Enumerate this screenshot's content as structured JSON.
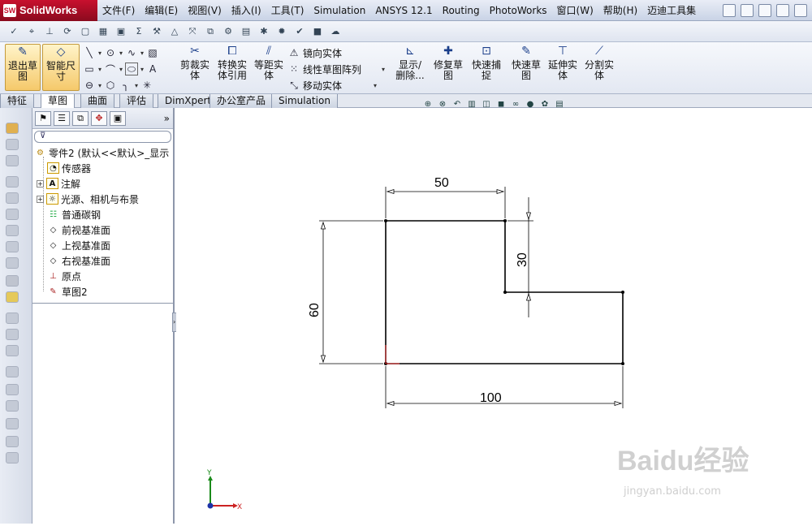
{
  "app": {
    "logo_text": "SolidWorks",
    "logo_mark": "SW"
  },
  "menu": [
    "文件(F)",
    "编辑(E)",
    "视图(V)",
    "插入(I)",
    "工具(T)",
    "Simulation",
    "ANSYS 12.1",
    "Routing",
    "PhotoWorks",
    "窗口(W)",
    "帮助(H)",
    "迈迪工具集"
  ],
  "sketch_tools": {
    "exit_sketch": "退出草\n图",
    "smart_dim": "智能尺\n寸",
    "trim": "剪裁实\n体",
    "convert": "转换实\n体引用",
    "offset": "等距实\n体",
    "mirror": "镜向实体",
    "linear_pattern": "线性草图阵列",
    "move": "移动实体",
    "display_delete": "显示/\n删除...",
    "repair": "修复草\n图",
    "quick_snap": "快速捕\n捉",
    "rapid_sketch": "快速草\n图",
    "extend": "延伸实\n体",
    "split": "分割实\n体"
  },
  "tabs": [
    "特征",
    "草图",
    "曲面",
    "评估",
    "DimXpert",
    "办公室产品",
    "Simulation"
  ],
  "active_tab": "草图",
  "tree": {
    "root": "零件2 (默认<<默认>_显示",
    "items": [
      "传感器",
      "注解",
      "光源、相机与布景",
      "普通碳钢",
      "前视基准面",
      "上视基准面",
      "右视基准面",
      "原点",
      "草图2"
    ]
  },
  "drawing": {
    "dimensions": {
      "top": "50",
      "right": "30",
      "left": "60",
      "bottom": "100"
    },
    "triad": {
      "y": "Y",
      "x": "X"
    }
  },
  "watermark": {
    "main": "Baidu经验",
    "sub": "jingyan.baidu.com"
  }
}
